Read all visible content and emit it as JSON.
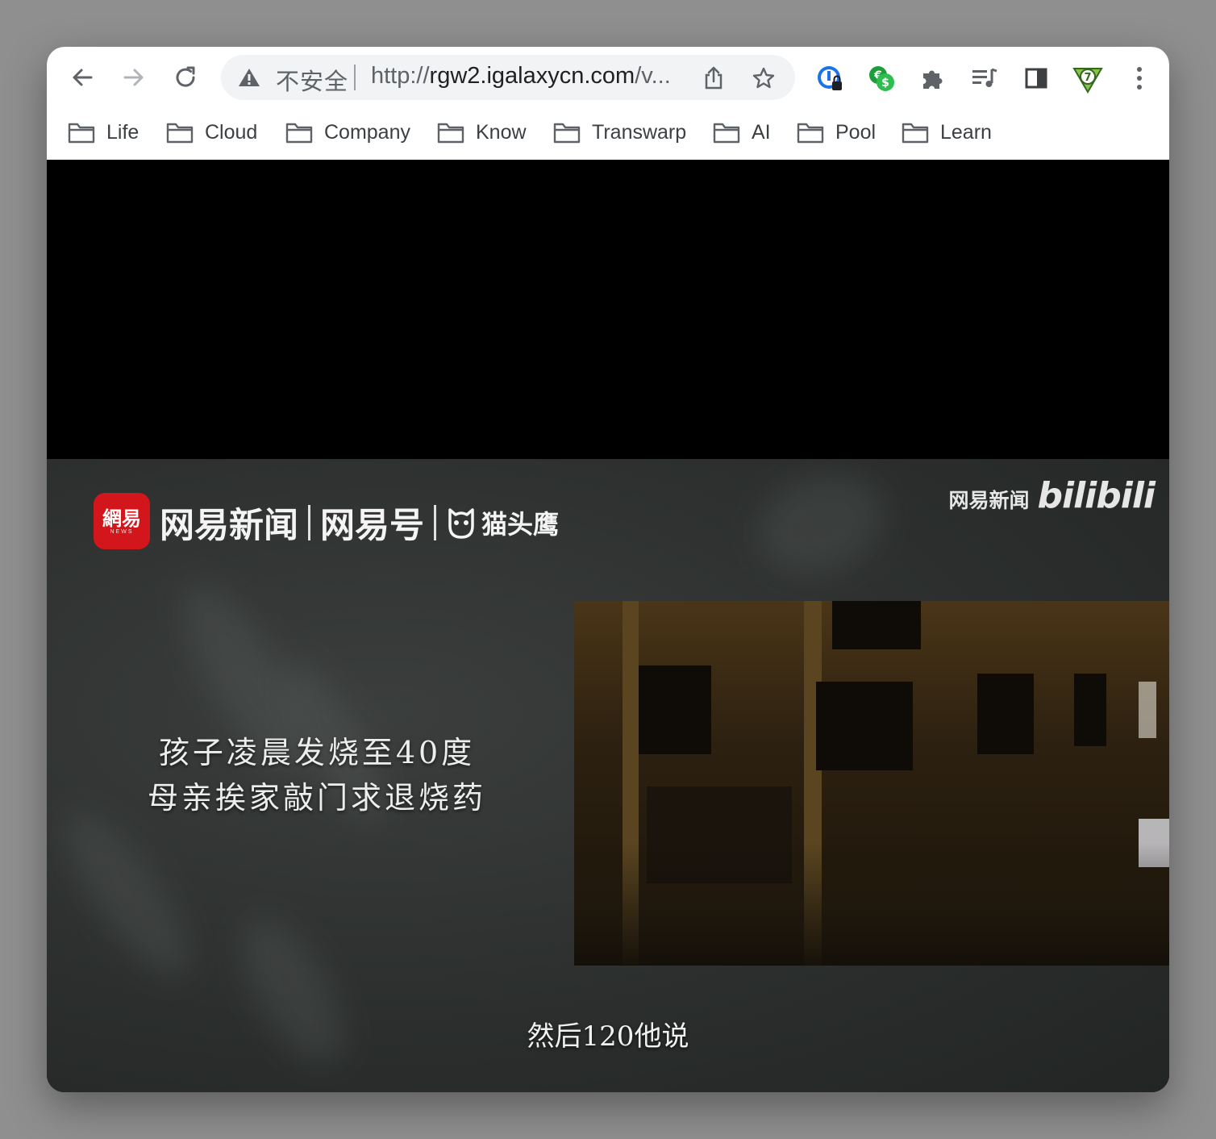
{
  "browser": {
    "omnibox": {
      "security_label": "不安全",
      "url_scheme": "http://",
      "url_host": "rgw2.igalaxycn.com",
      "url_rest": "/v..."
    },
    "bookmarks": [
      {
        "label": "Life"
      },
      {
        "label": "Cloud"
      },
      {
        "label": "Company"
      },
      {
        "label": "Know"
      },
      {
        "label": "Transwarp"
      },
      {
        "label": "AI"
      },
      {
        "label": "Pool"
      },
      {
        "label": "Learn"
      }
    ],
    "toolbar_icons": [
      "back-icon",
      "forward-icon",
      "reload-icon",
      "share-icon",
      "bookmark-star-icon",
      "password-manager-extension-icon",
      "currency-extension-icon",
      "extensions-puzzle-icon",
      "media-control-icon",
      "side-panel-icon",
      "sevenzip-extension-icon",
      "more-menu-icon"
    ]
  },
  "video": {
    "brand": {
      "badge_glyph": "網易",
      "badge_sub": "NEWS",
      "parts": [
        "网易新闻",
        "网易号",
        "猫头鹰"
      ]
    },
    "watermark": {
      "cn": "网易新闻",
      "bili": "bilibili"
    },
    "headline": {
      "line1": "孩子凌晨发烧至40度",
      "line2": "母亲挨家敲门求退烧药"
    },
    "subtitle": "然后120他说"
  },
  "colors": {
    "brand_red": "#d3161b",
    "toolbar_bg": "#ffffff",
    "omnibox_bg": "#f1f3f4"
  }
}
